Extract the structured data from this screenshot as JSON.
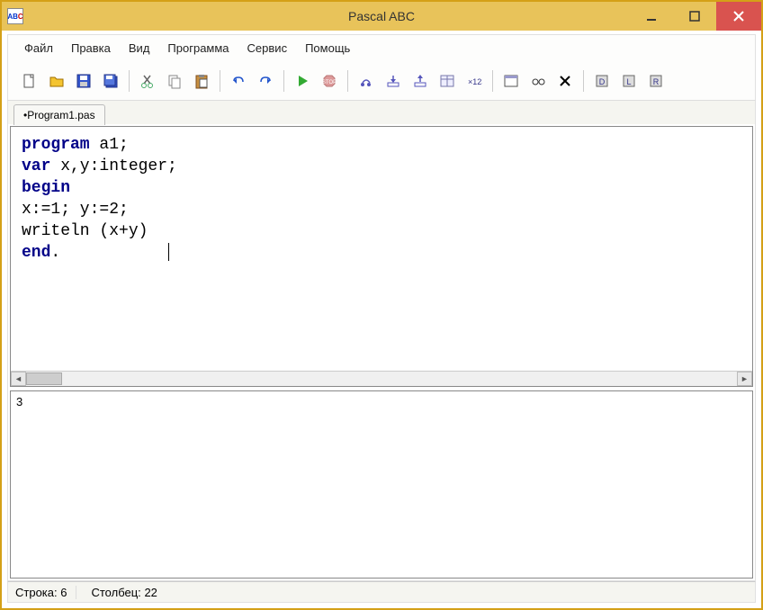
{
  "window": {
    "title": "Pascal ABC",
    "icon_label": "ABC"
  },
  "menu": {
    "items": [
      "Файл",
      "Правка",
      "Вид",
      "Программа",
      "Сервис",
      "Помощь"
    ]
  },
  "toolbar": {
    "icons": [
      "new-file-icon",
      "open-file-icon",
      "save-icon",
      "save-all-icon",
      "cut-icon",
      "copy-icon",
      "paste-icon",
      "undo-icon",
      "redo-icon",
      "run-icon",
      "stop-icon",
      "step-over-icon",
      "step-into-icon",
      "step-out-icon",
      "breakpoint-icon",
      "eval-icon",
      "window-icon",
      "watch-icon",
      "clear-icon",
      "compile-icon",
      "build-icon",
      "check-icon"
    ]
  },
  "tabs": {
    "active": "•Program1.pas"
  },
  "code": {
    "line1_kw": "program",
    "line1_rest": " a1;",
    "line2_kw": "var",
    "line2_rest": " x,y:integer;",
    "line3_kw": "begin",
    "line4": "x:=1; y:=2;",
    "line5": "writeln (x+y)",
    "line6_kw": "end",
    "line6_rest": "."
  },
  "output": {
    "text": "3"
  },
  "status": {
    "row_label": "Строка:",
    "row_value": "6",
    "col_label": "Столбец:",
    "col_value": "22"
  }
}
